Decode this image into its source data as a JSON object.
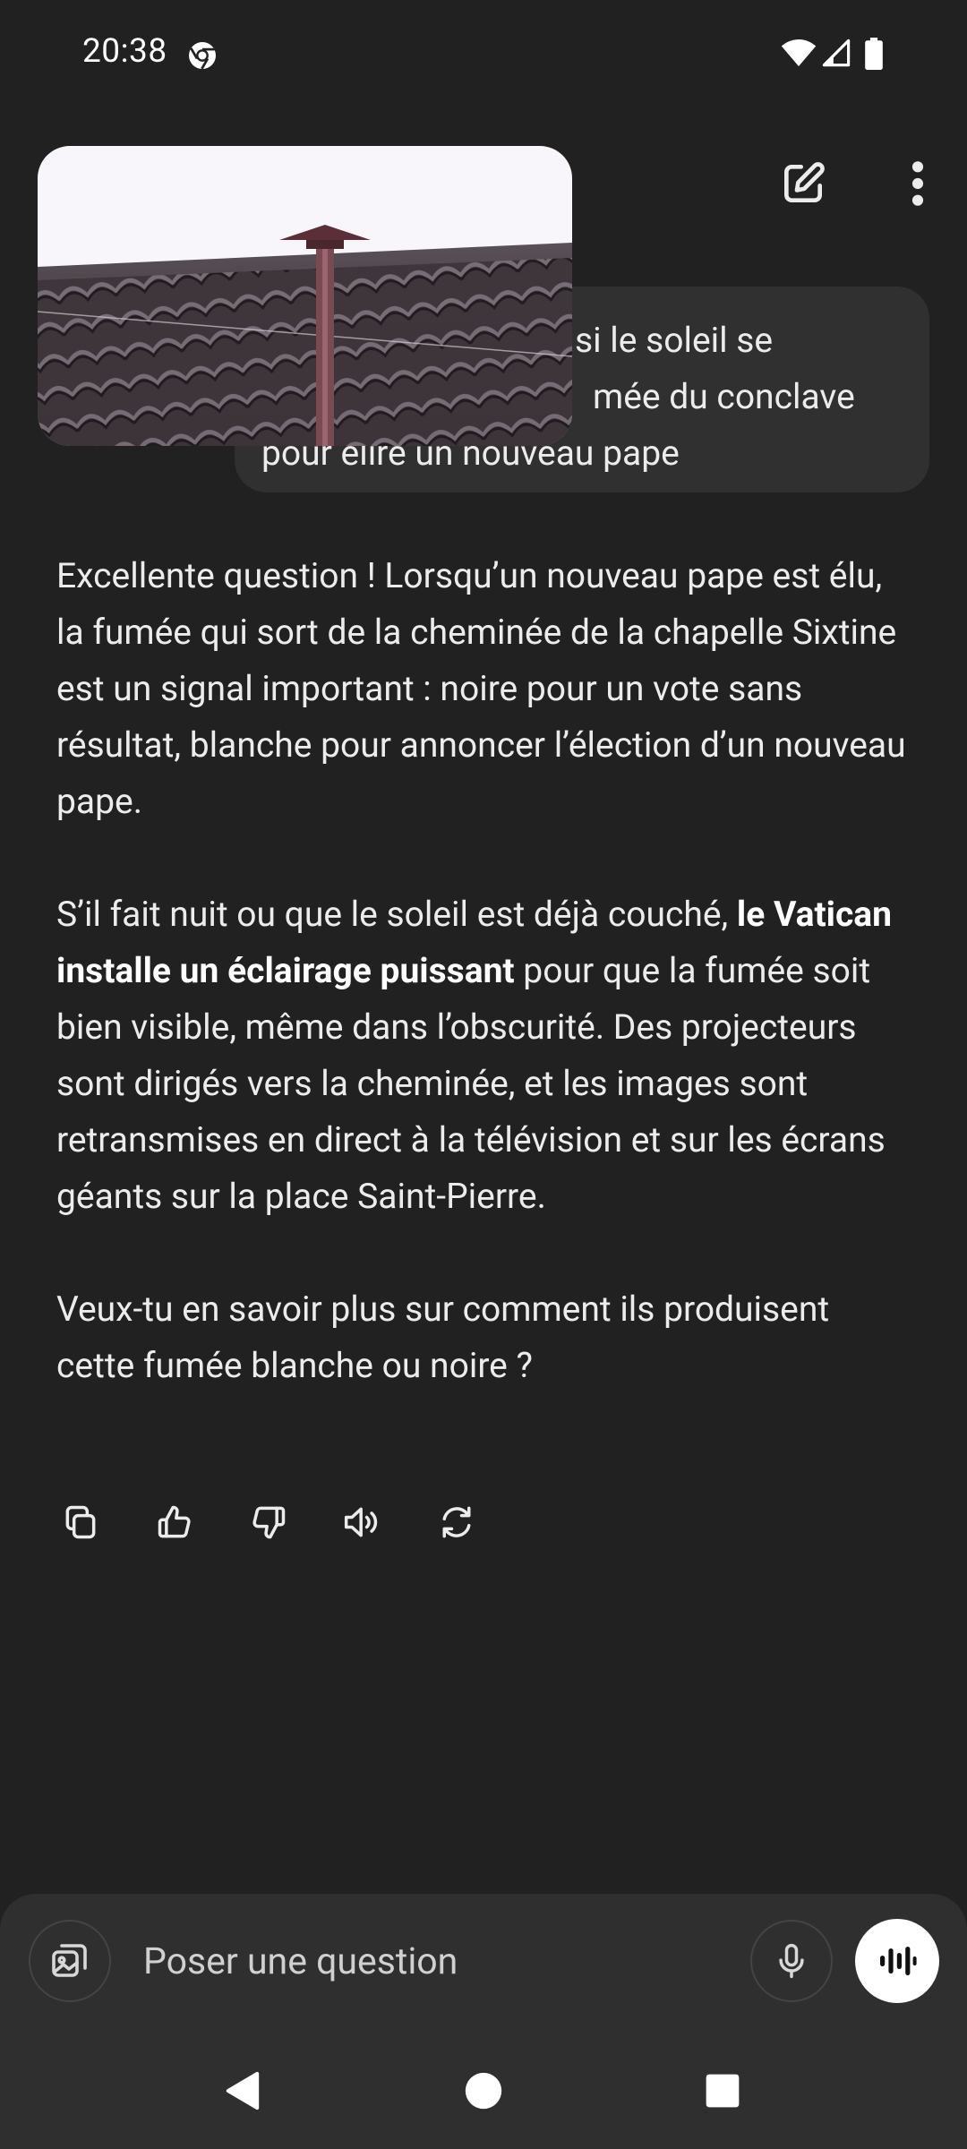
{
  "status_bar": {
    "time": "20:38",
    "icons": [
      "chrome-icon",
      "wifi-icon",
      "signal-icon",
      "battery-icon"
    ]
  },
  "header": {
    "actions": [
      {
        "icon": "new-chat-icon"
      },
      {
        "icon": "more-vertical-icon"
      }
    ]
  },
  "conversation": {
    "user_message": {
      "text": "si le soleil se mée du conclave pour élire un nouveau pape",
      "visible_lines": [
        "si le soleil se",
        "mée du conclave",
        "pour élire un nouveau pape"
      ],
      "attachment": "rooftop-chimney-photo"
    },
    "assistant_message": {
      "p1": "Excellente question ! Lorsqu’un nouveau pape est élu, la fumée qui sort de la cheminée de la chapelle Sixtine est un signal important : noire pour un vote sans résultat, blanche pour annoncer l’élection d’un nouveau pape.",
      "p2_before": "S’il fait nuit ou que le soleil est déjà couché, ",
      "p2_bold": "le Vatican installe un éclairage puissant",
      "p2_after": " pour que la fumée soit bien visible, même dans l’obscurité. Des projecteurs sont dirigés vers la cheminée, et les images sont retransmises en direct à la télévision et sur les écrans géants sur la place Saint-Pierre.",
      "p3": "Veux-tu en savoir plus sur comment ils produisent cette fumée blanche ou noire ?"
    },
    "message_actions": [
      "copy-icon",
      "thumbs-up-icon",
      "thumbs-down-icon",
      "read-aloud-icon",
      "regenerate-icon"
    ]
  },
  "composer": {
    "placeholder": "Poser une question",
    "value": "",
    "icons": [
      "image-attach-icon",
      "microphone-icon",
      "voice-mode-icon"
    ]
  },
  "colors": {
    "background": "#212121",
    "bubble": "#303030",
    "composer": "#2f2f2f",
    "text": "#ececec"
  }
}
